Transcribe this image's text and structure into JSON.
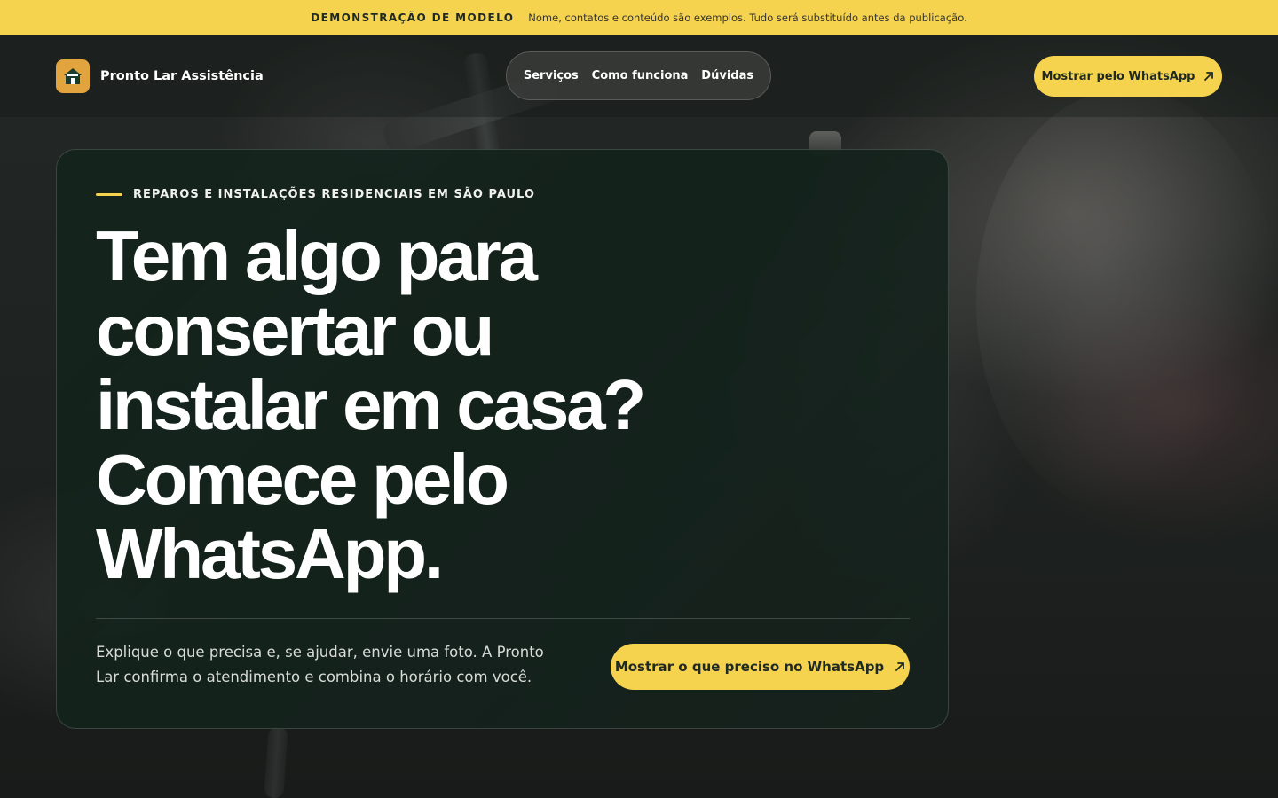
{
  "banner": {
    "tag": "DEMONSTRAÇÃO DE MODELO",
    "note": "Nome, contatos e conteúdo são exemplos. Tudo será substituído antes da publicação."
  },
  "brand": {
    "name": "Pronto Lar Assistência",
    "logo_icon": "house-icon"
  },
  "nav": {
    "items": [
      {
        "label": "Serviços"
      },
      {
        "label": "Como funciona"
      },
      {
        "label": "Dúvidas"
      }
    ]
  },
  "header_cta": {
    "label": "Mostrar pelo WhatsApp",
    "icon": "arrow-up-right-icon"
  },
  "hero": {
    "eyebrow": "REPAROS E INSTALAÇÕES RESIDENCIAIS EM SÃO PAULO",
    "headline": "Tem algo para consertar ou instalar em casa? Comece pelo WhatsApp.",
    "lede": "Explique o que precisa e, se ajudar, envie uma foto. A Pronto Lar confirma o atendimento e combina o horário com você.",
    "cta_label": "Mostrar o que preciso no WhatsApp",
    "cta_icon": "arrow-up-right-icon"
  },
  "colors": {
    "accent": "#f6d34e",
    "logo_bg": "#e2a43f",
    "card_bg": "#14241d",
    "dark_text": "#1f2a24"
  }
}
